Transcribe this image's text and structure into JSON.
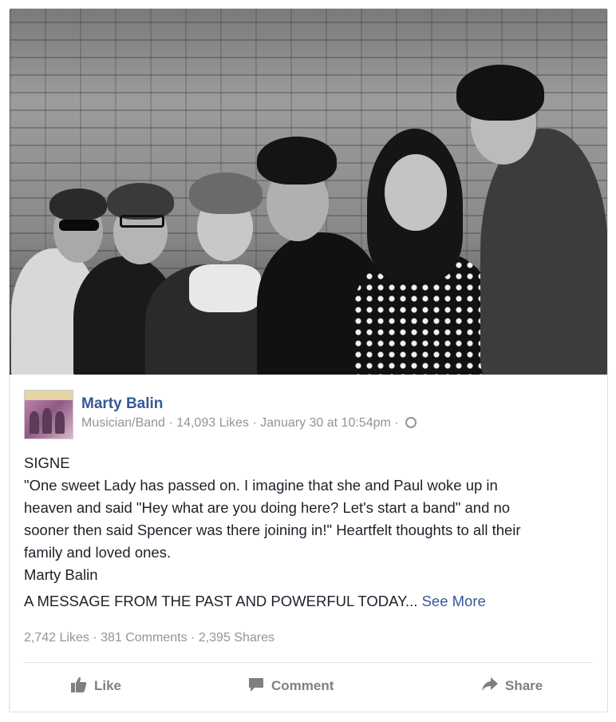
{
  "post": {
    "page_name": "Marty Balin",
    "category": "Musician/Band",
    "likes_count": "14,093 Likes",
    "timestamp": "January 30 at 10:54pm",
    "sep": "·",
    "body_lines": [
      "SIGNE",
      "\"One sweet Lady has passed on. I imagine that she and Paul woke up in",
      "heaven and said \"Hey what are you doing here? Let's start a band\" and no",
      "sooner then said Spencer was there joining in!\" Heartfelt thoughts to all their",
      "family and loved ones.",
      "Marty Balin"
    ],
    "teaser": "A MESSAGE FROM THE PAST AND POWERFUL TODAY...",
    "see_more": "See More",
    "stats": {
      "likes": "2,742 Likes",
      "comments": "381 Comments",
      "shares": "2,395 Shares"
    }
  },
  "actions": {
    "like": "Like",
    "comment": "Comment",
    "share": "Share"
  },
  "icons": {
    "privacy": "globe-icon",
    "like": "thumbs-up-icon",
    "comment": "comment-icon",
    "share": "share-arrow-icon"
  },
  "colors": {
    "link": "#365899",
    "secondary_text": "#90949c",
    "action_text": "#7f7f7f"
  }
}
